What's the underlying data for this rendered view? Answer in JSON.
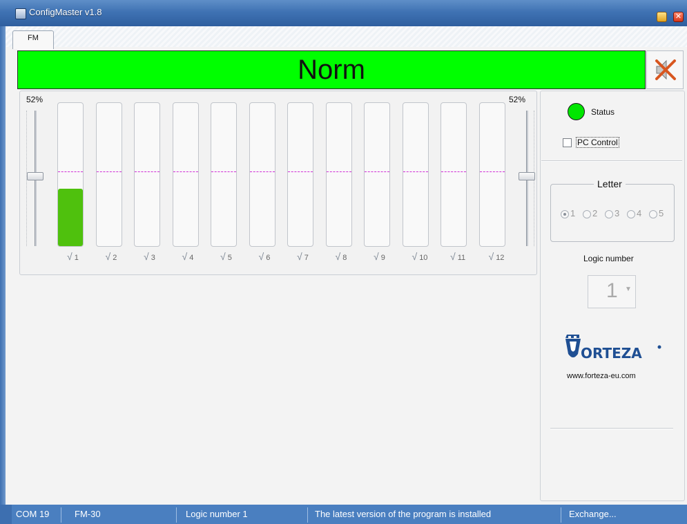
{
  "window": {
    "title": "ConfigMaster v1.8"
  },
  "tabs": [
    {
      "label": "FM"
    }
  ],
  "banner": {
    "text": "Norm",
    "color": "#00ff00"
  },
  "channels": {
    "left_percent": "52%",
    "right_percent": "52%",
    "left_slider_value": 0.52,
    "right_slider_value": 0.52,
    "threshold_level": 0.52,
    "items": [
      {
        "label": "1",
        "checked": true,
        "level": 0.4
      },
      {
        "label": "2",
        "checked": true,
        "level": 0
      },
      {
        "label": "3",
        "checked": true,
        "level": 0
      },
      {
        "label": "4",
        "checked": true,
        "level": 0
      },
      {
        "label": "5",
        "checked": true,
        "level": 0
      },
      {
        "label": "6",
        "checked": true,
        "level": 0
      },
      {
        "label": "7",
        "checked": true,
        "level": 0
      },
      {
        "label": "8",
        "checked": true,
        "level": 0
      },
      {
        "label": "9",
        "checked": true,
        "level": 0
      },
      {
        "label": "10",
        "checked": true,
        "level": 0
      },
      {
        "label": "11",
        "checked": true,
        "level": 0
      },
      {
        "label": "12",
        "checked": true,
        "level": 0
      }
    ]
  },
  "side": {
    "status_label": "Status",
    "status_color": "#00e600",
    "pc_control_label": "PC Control",
    "letter_title": "Letter",
    "letter_options": [
      "1",
      "2",
      "3",
      "4",
      "5"
    ],
    "letter_selected": "1",
    "logic_number_label": "Logic number",
    "logic_number_value": "1",
    "logo_url": "www.forteza-eu.com"
  },
  "statusbar": {
    "port": "COM 19",
    "device": "FM-30",
    "logic": "Logic number 1",
    "message": "The latest version of the program is installed",
    "exchange": "Exchange..."
  }
}
